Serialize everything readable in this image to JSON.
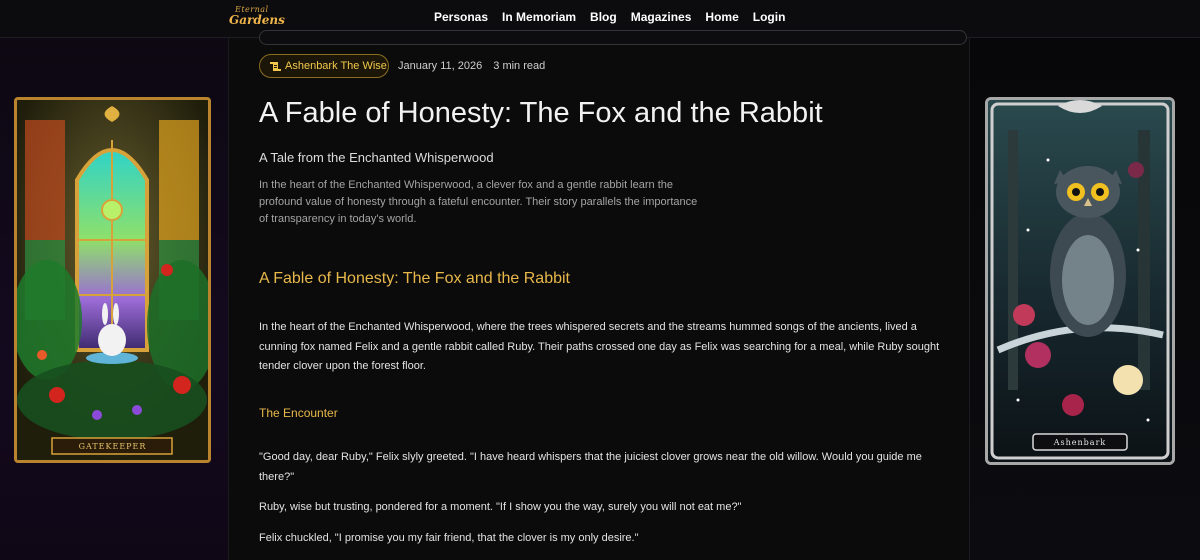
{
  "nav": {
    "logo_line1": "Eternal",
    "logo_line2": "Gardens",
    "links": [
      "Personas",
      "In Memoriam",
      "Blog",
      "Magazines",
      "Home",
      "Login"
    ]
  },
  "article": {
    "author": "Ashenbark The Wise",
    "date": "January 11, 2026",
    "read_time": "3 min read",
    "title": "A Fable of Honesty: The Fox and the Rabbit",
    "subtitle": "A Tale from the Enchanted Whisperwood",
    "summary": "In the heart of the Enchanted Whisperwood, a clever fox and a gentle rabbit learn the profound value of honesty through a fateful encounter. Their story parallels the importance of transparency in today's world.",
    "section_heading": "A Fable of Honesty: The Fox and the Rabbit",
    "paragraph1": "In the heart of the Enchanted Whisperwood, where the trees whispered secrets and the streams hummed songs of the ancients, lived a cunning fox named Felix and a gentle rabbit called Ruby. Their paths crossed one day as Felix was searching for a meal, while Ruby sought tender clover upon the forest floor.",
    "subheading": "The Encounter",
    "paragraph2": "\"Good day, dear Ruby,\" Felix slyly greeted. \"I have heard whispers that the juiciest clover grows near the old willow. Would you guide me there?\"",
    "paragraph3": "Ruby, wise but trusting, pondered for a moment. \"If I show you the way, surely you will not eat me?\"",
    "paragraph4": "Felix chuckled, \"I promise you my fair friend, that the clover is my only desire.\""
  },
  "cards": {
    "left_label": "GATEKEEPER",
    "right_label": "Ashenbark"
  },
  "colors": {
    "accent_gold": "#e8b84a",
    "background": "#0b0b0d"
  },
  "icons": {
    "author": "scroll-icon"
  }
}
